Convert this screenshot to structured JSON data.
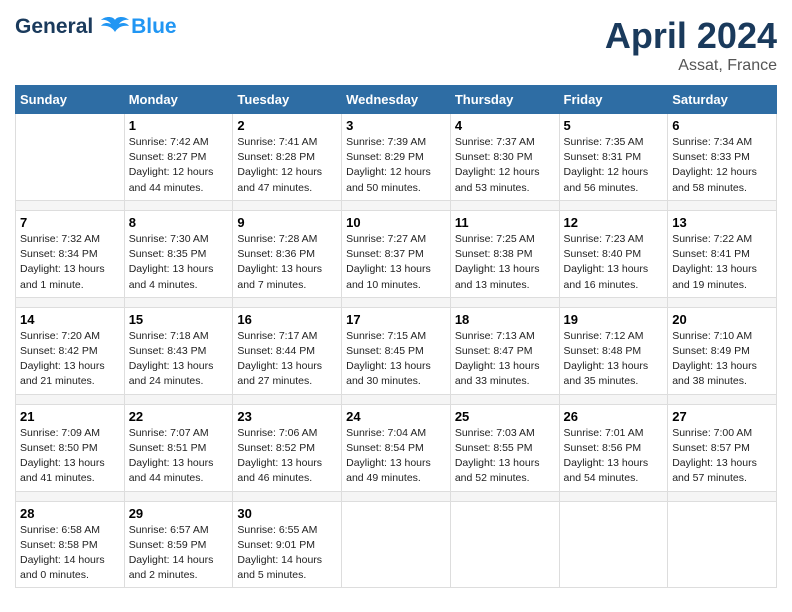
{
  "header": {
    "logo_line1": "General",
    "logo_line2": "Blue",
    "month": "April 2024",
    "location": "Assat, France"
  },
  "columns": [
    "Sunday",
    "Monday",
    "Tuesday",
    "Wednesday",
    "Thursday",
    "Friday",
    "Saturday"
  ],
  "weeks": [
    [
      {
        "day": "",
        "info": ""
      },
      {
        "day": "1",
        "info": "Sunrise: 7:42 AM\nSunset: 8:27 PM\nDaylight: 12 hours\nand 44 minutes."
      },
      {
        "day": "2",
        "info": "Sunrise: 7:41 AM\nSunset: 8:28 PM\nDaylight: 12 hours\nand 47 minutes."
      },
      {
        "day": "3",
        "info": "Sunrise: 7:39 AM\nSunset: 8:29 PM\nDaylight: 12 hours\nand 50 minutes."
      },
      {
        "day": "4",
        "info": "Sunrise: 7:37 AM\nSunset: 8:30 PM\nDaylight: 12 hours\nand 53 minutes."
      },
      {
        "day": "5",
        "info": "Sunrise: 7:35 AM\nSunset: 8:31 PM\nDaylight: 12 hours\nand 56 minutes."
      },
      {
        "day": "6",
        "info": "Sunrise: 7:34 AM\nSunset: 8:33 PM\nDaylight: 12 hours\nand 58 minutes."
      }
    ],
    [
      {
        "day": "7",
        "info": "Sunrise: 7:32 AM\nSunset: 8:34 PM\nDaylight: 13 hours\nand 1 minute."
      },
      {
        "day": "8",
        "info": "Sunrise: 7:30 AM\nSunset: 8:35 PM\nDaylight: 13 hours\nand 4 minutes."
      },
      {
        "day": "9",
        "info": "Sunrise: 7:28 AM\nSunset: 8:36 PM\nDaylight: 13 hours\nand 7 minutes."
      },
      {
        "day": "10",
        "info": "Sunrise: 7:27 AM\nSunset: 8:37 PM\nDaylight: 13 hours\nand 10 minutes."
      },
      {
        "day": "11",
        "info": "Sunrise: 7:25 AM\nSunset: 8:38 PM\nDaylight: 13 hours\nand 13 minutes."
      },
      {
        "day": "12",
        "info": "Sunrise: 7:23 AM\nSunset: 8:40 PM\nDaylight: 13 hours\nand 16 minutes."
      },
      {
        "day": "13",
        "info": "Sunrise: 7:22 AM\nSunset: 8:41 PM\nDaylight: 13 hours\nand 19 minutes."
      }
    ],
    [
      {
        "day": "14",
        "info": "Sunrise: 7:20 AM\nSunset: 8:42 PM\nDaylight: 13 hours\nand 21 minutes."
      },
      {
        "day": "15",
        "info": "Sunrise: 7:18 AM\nSunset: 8:43 PM\nDaylight: 13 hours\nand 24 minutes."
      },
      {
        "day": "16",
        "info": "Sunrise: 7:17 AM\nSunset: 8:44 PM\nDaylight: 13 hours\nand 27 minutes."
      },
      {
        "day": "17",
        "info": "Sunrise: 7:15 AM\nSunset: 8:45 PM\nDaylight: 13 hours\nand 30 minutes."
      },
      {
        "day": "18",
        "info": "Sunrise: 7:13 AM\nSunset: 8:47 PM\nDaylight: 13 hours\nand 33 minutes."
      },
      {
        "day": "19",
        "info": "Sunrise: 7:12 AM\nSunset: 8:48 PM\nDaylight: 13 hours\nand 35 minutes."
      },
      {
        "day": "20",
        "info": "Sunrise: 7:10 AM\nSunset: 8:49 PM\nDaylight: 13 hours\nand 38 minutes."
      }
    ],
    [
      {
        "day": "21",
        "info": "Sunrise: 7:09 AM\nSunset: 8:50 PM\nDaylight: 13 hours\nand 41 minutes."
      },
      {
        "day": "22",
        "info": "Sunrise: 7:07 AM\nSunset: 8:51 PM\nDaylight: 13 hours\nand 44 minutes."
      },
      {
        "day": "23",
        "info": "Sunrise: 7:06 AM\nSunset: 8:52 PM\nDaylight: 13 hours\nand 46 minutes."
      },
      {
        "day": "24",
        "info": "Sunrise: 7:04 AM\nSunset: 8:54 PM\nDaylight: 13 hours\nand 49 minutes."
      },
      {
        "day": "25",
        "info": "Sunrise: 7:03 AM\nSunset: 8:55 PM\nDaylight: 13 hours\nand 52 minutes."
      },
      {
        "day": "26",
        "info": "Sunrise: 7:01 AM\nSunset: 8:56 PM\nDaylight: 13 hours\nand 54 minutes."
      },
      {
        "day": "27",
        "info": "Sunrise: 7:00 AM\nSunset: 8:57 PM\nDaylight: 13 hours\nand 57 minutes."
      }
    ],
    [
      {
        "day": "28",
        "info": "Sunrise: 6:58 AM\nSunset: 8:58 PM\nDaylight: 14 hours\nand 0 minutes."
      },
      {
        "day": "29",
        "info": "Sunrise: 6:57 AM\nSunset: 8:59 PM\nDaylight: 14 hours\nand 2 minutes."
      },
      {
        "day": "30",
        "info": "Sunrise: 6:55 AM\nSunset: 9:01 PM\nDaylight: 14 hours\nand 5 minutes."
      },
      {
        "day": "",
        "info": ""
      },
      {
        "day": "",
        "info": ""
      },
      {
        "day": "",
        "info": ""
      },
      {
        "day": "",
        "info": ""
      }
    ]
  ]
}
